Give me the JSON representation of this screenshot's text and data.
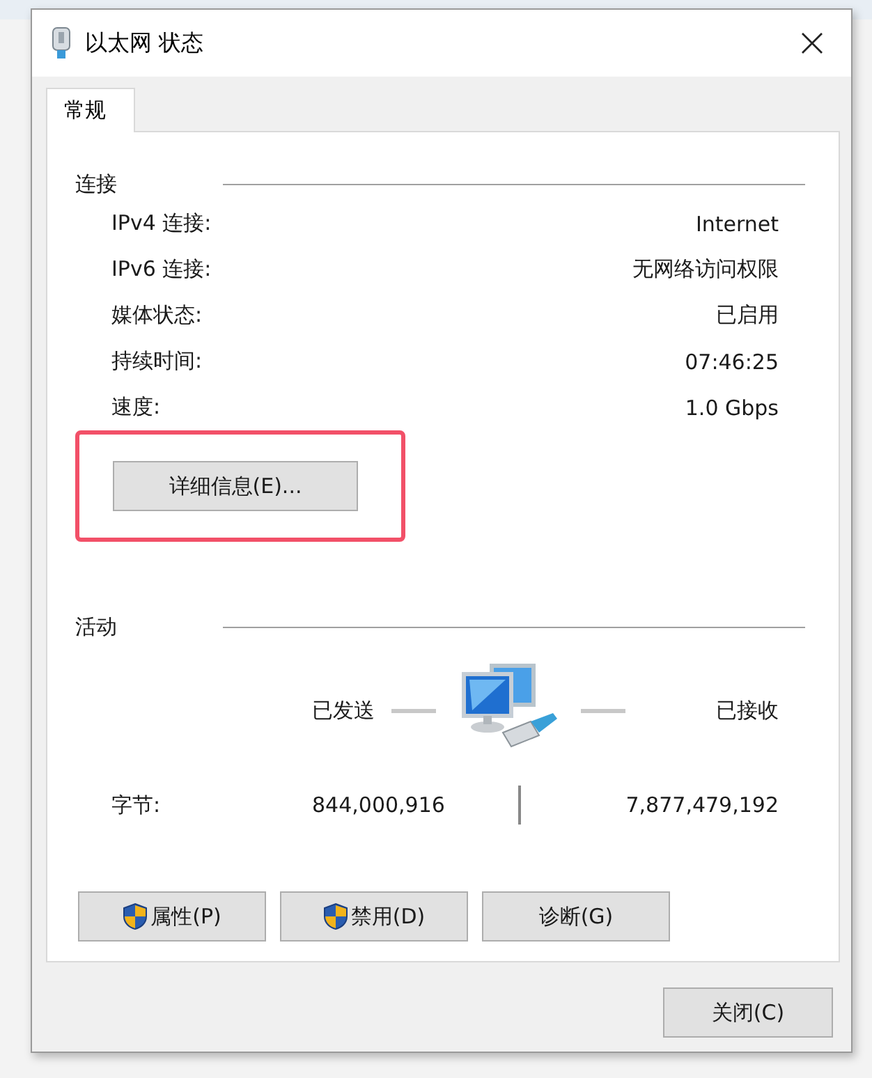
{
  "window": {
    "title": "以太网 状态"
  },
  "tabs": [
    {
      "label": "常规",
      "selected": true
    }
  ],
  "connection": {
    "heading": "连接",
    "rows": [
      {
        "label": "IPv4 连接:",
        "value": "Internet"
      },
      {
        "label": "IPv6 连接:",
        "value": "无网络访问权限"
      },
      {
        "label": "媒体状态:",
        "value": "已启用"
      },
      {
        "label": "持续时间:",
        "value": "07:46:25"
      },
      {
        "label": "速度:",
        "value": "1.0 Gbps"
      }
    ],
    "details_button": "详细信息(E)...",
    "highlighted": true
  },
  "activity": {
    "heading": "活动",
    "sent_label": "已发送",
    "received_label": "已接收",
    "bytes_label": "字节:",
    "sent_bytes": "844,000,916",
    "received_bytes": "7,877,479,192"
  },
  "buttons": [
    {
      "label": "属性(P)",
      "shield": true
    },
    {
      "label": "禁用(D)",
      "shield": true
    },
    {
      "label": "诊断(G)",
      "shield": false
    }
  ],
  "close_button": "关闭(C)"
}
